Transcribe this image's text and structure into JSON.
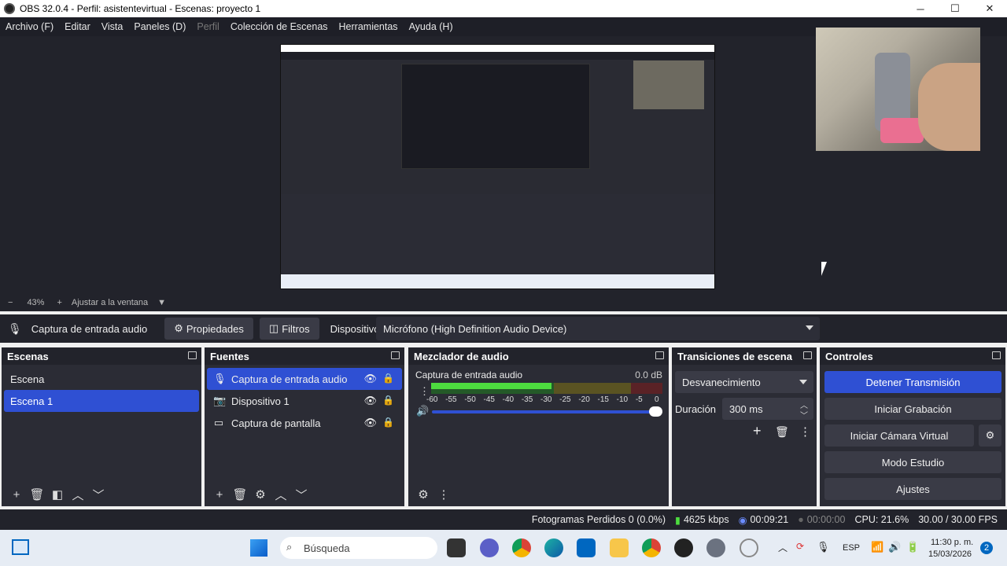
{
  "window": {
    "title": "OBS 32.0.4 - Perfil: asistentevirtual - Escenas: proyecto 1",
    "minimize_icon": "─",
    "maximize_icon": "☐",
    "close_icon": "✕"
  },
  "menu": {
    "items": [
      "Archivo (F)",
      "Editar",
      "Vista",
      "Paneles (D)",
      "Perfil",
      "Colección de Escenas",
      "Herramientas",
      "Ayuda (H)"
    ]
  },
  "zoom": {
    "minus": "−",
    "value": "43%",
    "plus": "+",
    "fit": "Ajustar a la ventana",
    "arrow": "▼"
  },
  "sourcebar": {
    "source_name": "Captura de entrada audio",
    "properties": "Propiedades",
    "filters": "Filtros",
    "device_label": "Dispositivo",
    "device_value": "Micrófono (High Definition Audio Device)"
  },
  "scenes": {
    "title": "Escenas",
    "items": [
      "Escena",
      "Escena 1"
    ],
    "selected": 1
  },
  "sources": {
    "title": "Fuentes",
    "items": [
      {
        "name": "Captura de entrada audio",
        "icon": "microphone-icon"
      },
      {
        "name": "Dispositivo 1",
        "icon": "camera-icon"
      },
      {
        "name": "Captura de pantalla",
        "icon": "monitor-icon"
      }
    ],
    "selected": 0
  },
  "mixer": {
    "title": "Mezclador de audio",
    "channel": "Captura de entrada audio",
    "db": "0.0 dB",
    "ticks": [
      "-60",
      "-55",
      "-50",
      "-45",
      "-40",
      "-35",
      "-30",
      "-25",
      "-20",
      "-15",
      "-10",
      "-5",
      "0"
    ],
    "level_fraction": 0.52,
    "volume_fraction": 1.0
  },
  "transitions": {
    "title": "Transiciones de escena",
    "selected": "Desvanecimiento",
    "duration_label": "Duración",
    "duration_value": "300 ms"
  },
  "controls": {
    "title": "Controles",
    "stop_stream": "Detener Transmisión",
    "start_recording": "Iniciar Grabación",
    "start_virtual_cam": "Iniciar Cámara Virtual",
    "studio_mode": "Modo Estudio",
    "settings": "Ajustes"
  },
  "status": {
    "dropped": "Fotogramas Perdidos 0 (0.0%)",
    "bitrate": "4625 kbps",
    "stream_time": "00:09:21",
    "record_time": "00:00:00",
    "cpu": "CPU: 21.6%",
    "fps": "30.00 / 30.00 FPS"
  },
  "taskbar": {
    "search_placeholder": "Búsqueda",
    "language": "ESP",
    "time": "11:30 p. m.",
    "date": "15/03/2026",
    "notifications": "2"
  },
  "colors": {
    "accent": "#2f50d3",
    "panel": "#2b2c35",
    "background": "#22232b"
  }
}
